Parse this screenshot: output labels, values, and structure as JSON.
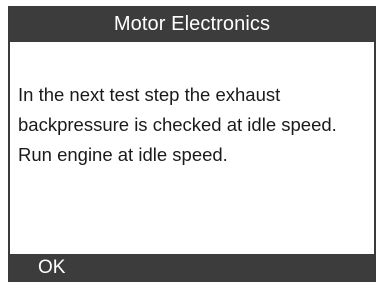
{
  "screen": {
    "title": "Motor Electronics",
    "message_lines": [
      "In the next test step the exhaust",
      "backpressure is checked at idle speed.",
      "Run engine at idle speed."
    ],
    "soft_keys": {
      "ok_label": "OK"
    }
  },
  "colors": {
    "bar_background": "#3c3c3c",
    "bar_text": "#ffffff",
    "body_background": "#ffffff",
    "body_text": "#1a1a1a"
  }
}
